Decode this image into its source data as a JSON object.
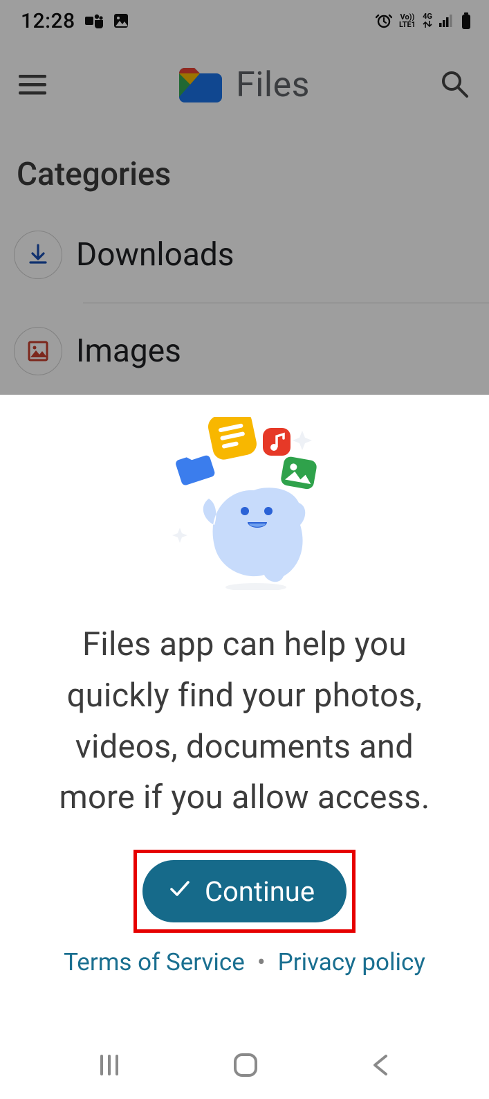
{
  "status": {
    "time": "12:28",
    "netTop": "Vo))",
    "netBottom": "LTE1",
    "four_g": "4G"
  },
  "app": {
    "title": "Files"
  },
  "categories": {
    "heading": "Categories",
    "items": [
      "Downloads",
      "Images"
    ]
  },
  "sheet": {
    "message": "Files app can help you quickly find your photos, videos, documents and more if you allow access.",
    "continue": "Continue",
    "tos": "Terms of Service",
    "privacy": "Privacy policy"
  }
}
